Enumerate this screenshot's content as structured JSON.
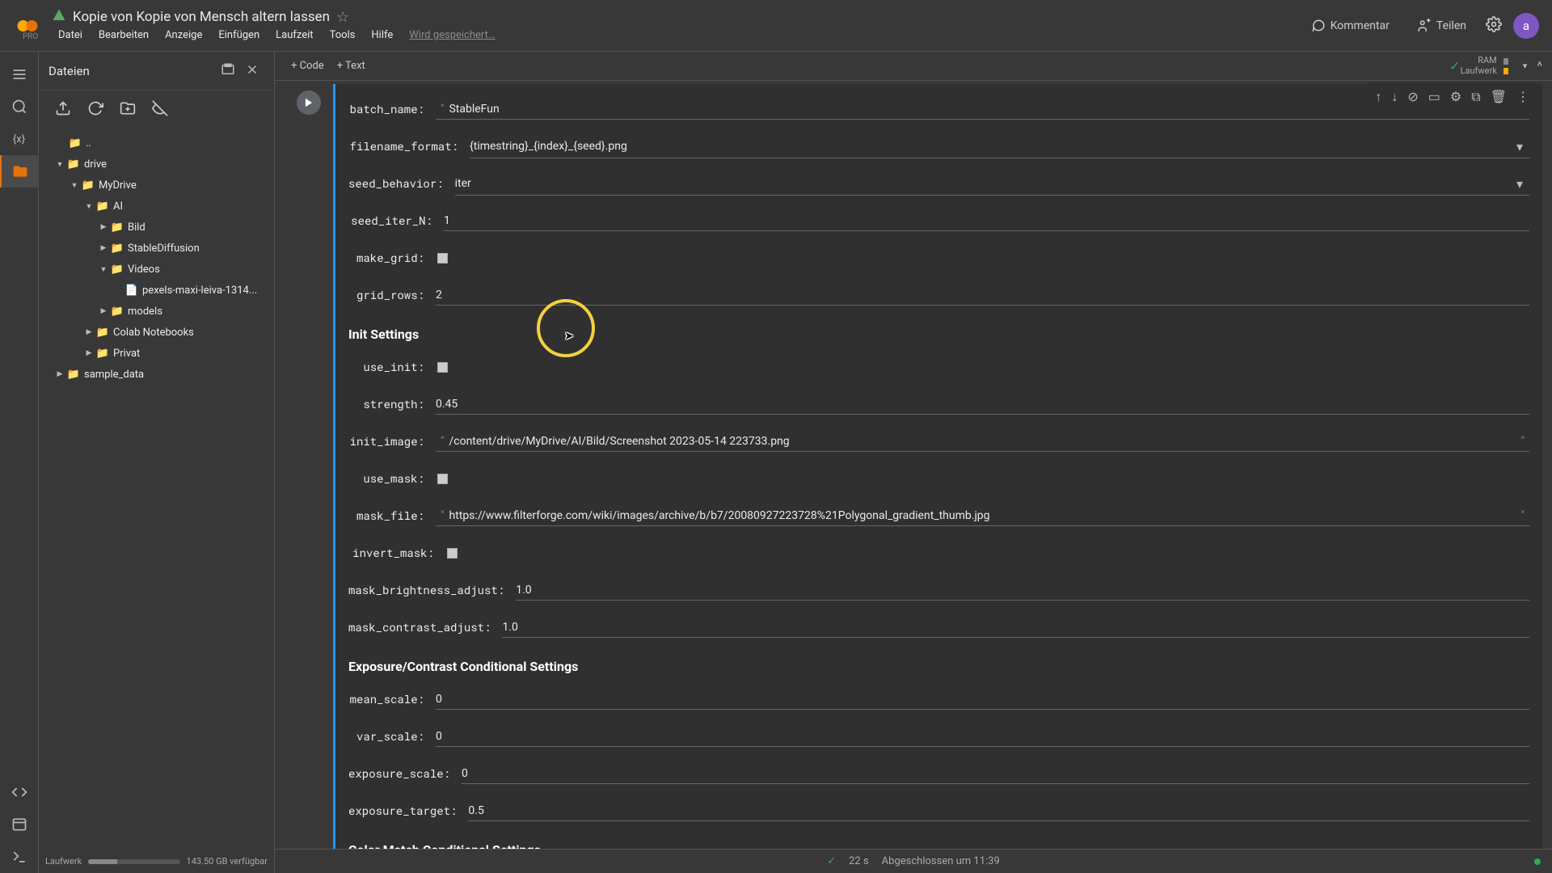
{
  "header": {
    "pro": "PRO",
    "title": "Kopie von Kopie von Mensch altern lassen",
    "menu": [
      "Datei",
      "Bearbeiten",
      "Anzeige",
      "Einfügen",
      "Laufzeit",
      "Tools",
      "Hilfe"
    ],
    "saving": "Wird gespeichert…",
    "comment": "Kommentar",
    "share": "Teilen",
    "avatar": "a"
  },
  "nb_toolbar": {
    "code": "+ Code",
    "text": "+ Text",
    "ram1": "RAM",
    "ram2": "Laufwerk"
  },
  "file_panel": {
    "title": "Dateien",
    "tree": {
      "dots": "..",
      "drive": "drive",
      "mydrive": "MyDrive",
      "ai": "AI",
      "bild": "Bild",
      "sd": "StableDiffusion",
      "videos": "Videos",
      "pexels": "pexels-maxi-leiva-1314...",
      "models": "models",
      "colab": "Colab Notebooks",
      "privat": "Privat",
      "sample": "sample_data"
    },
    "footer_label": "Laufwerk",
    "footer_free": "143.50 GB verfügbar"
  },
  "form": {
    "batch_name": {
      "label": "batch_name:",
      "value": "StableFun"
    },
    "filename_format": {
      "label": "filename_format:",
      "value": "{timestring}_{index}_{seed}.png"
    },
    "seed_behavior": {
      "label": "seed_behavior:",
      "value": "iter"
    },
    "seed_iter_n": {
      "label": "seed_iter_N:",
      "value": "1"
    },
    "make_grid": {
      "label": "make_grid:"
    },
    "grid_rows": {
      "label": "grid_rows:",
      "value": "2"
    },
    "sec_init": "Init Settings",
    "use_init": {
      "label": "use_init:"
    },
    "strength": {
      "label": "strength:",
      "value": "0.45"
    },
    "init_image": {
      "label": "init_image:",
      "value": "/content/drive/MyDrive/AI/Bild/Screenshot 2023-05-14 223733.png"
    },
    "use_mask": {
      "label": "use_mask:"
    },
    "mask_file": {
      "label": "mask_file:",
      "value": "https://www.filterforge.com/wiki/images/archive/b/b7/20080927223728%21Polygonal_gradient_thumb.jpg"
    },
    "invert_mask": {
      "label": "invert_mask:"
    },
    "mask_brightness": {
      "label": "mask_brightness_adjust:",
      "value": "1.0"
    },
    "mask_contrast": {
      "label": "mask_contrast_adjust:",
      "value": "1.0"
    },
    "sec_exposure": "Exposure/Contrast Conditional Settings",
    "mean_scale": {
      "label": "mean_scale:",
      "value": "0"
    },
    "var_scale": {
      "label": "var_scale:",
      "value": "0"
    },
    "exposure_scale": {
      "label": "exposure_scale:",
      "value": "0"
    },
    "exposure_target": {
      "label": "exposure_target:",
      "value": "0.5"
    },
    "sec_color": "Color Match Conditional Settings"
  },
  "status": {
    "time": "22 s",
    "done": "Abgeschlossen um 11:39"
  }
}
